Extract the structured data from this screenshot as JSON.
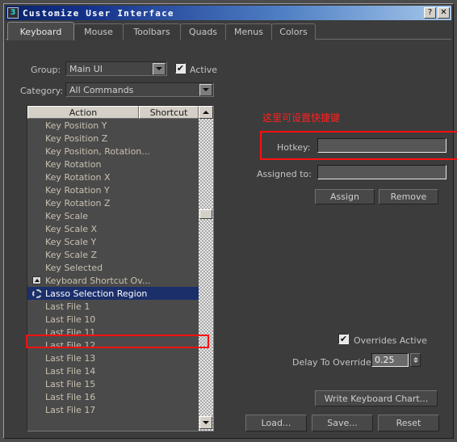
{
  "window": {
    "title": "Customize User Interface",
    "app_icon": "max-app-icon",
    "help_button": "?",
    "close_button": "✕"
  },
  "tabs": [
    {
      "label": "Keyboard",
      "active": true
    },
    {
      "label": "Mouse",
      "active": false
    },
    {
      "label": "Toolbars",
      "active": false
    },
    {
      "label": "Quads",
      "active": false
    },
    {
      "label": "Menus",
      "active": false
    },
    {
      "label": "Colors",
      "active": false
    }
  ],
  "left": {
    "group_label": "Group:",
    "group_value": "Main UI",
    "active_label": "Active",
    "active_checked": true,
    "active_check_glyph": "✔",
    "category_label": "Category:",
    "category_value": "All Commands",
    "columns": {
      "action": "Action",
      "shortcut": "Shortcut"
    },
    "rows": [
      {
        "label": "Key Position Y",
        "icon": "",
        "selected": false
      },
      {
        "label": "Key Position Z",
        "icon": "",
        "selected": false
      },
      {
        "label": "Key Position, Rotation...",
        "icon": "",
        "selected": false
      },
      {
        "label": "Key Rotation",
        "icon": "",
        "selected": false
      },
      {
        "label": "Key Rotation X",
        "icon": "",
        "selected": false
      },
      {
        "label": "Key Rotation Y",
        "icon": "",
        "selected": false
      },
      {
        "label": "Key Rotation Z",
        "icon": "",
        "selected": false
      },
      {
        "label": "Key Scale",
        "icon": "",
        "selected": false
      },
      {
        "label": "Key Scale X",
        "icon": "",
        "selected": false
      },
      {
        "label": "Key Scale Y",
        "icon": "",
        "selected": false
      },
      {
        "label": "Key Scale Z",
        "icon": "",
        "selected": false
      },
      {
        "label": "Key Selected",
        "icon": "",
        "selected": false
      },
      {
        "label": "Keyboard Shortcut Ov...",
        "icon": "keyboard-icon",
        "selected": false
      },
      {
        "label": "Lasso Selection Region",
        "icon": "lasso-icon",
        "selected": true
      },
      {
        "label": "Last File 1",
        "icon": "",
        "selected": false
      },
      {
        "label": "Last File 10",
        "icon": "",
        "selected": false
      },
      {
        "label": "Last File 11",
        "icon": "",
        "selected": false
      },
      {
        "label": "Last File 12",
        "icon": "",
        "selected": false
      },
      {
        "label": "Last File 13",
        "icon": "",
        "selected": false
      },
      {
        "label": "Last File 14",
        "icon": "",
        "selected": false
      },
      {
        "label": "Last File 15",
        "icon": "",
        "selected": false
      },
      {
        "label": "Last File 16",
        "icon": "",
        "selected": false
      },
      {
        "label": "Last File 17",
        "icon": "",
        "selected": false
      }
    ]
  },
  "right": {
    "annotation": "这里可设置快捷键",
    "annotation_color": "#ff2020",
    "hotkey_label": "Hotkey:",
    "hotkey_value": "",
    "hotkey_placeholder": "",
    "assigned_label": "Assigned to:",
    "assigned_value": "",
    "assign_button": "Assign",
    "remove_button": "Remove",
    "overrides_label": "Overrides Active",
    "overrides_checked": true,
    "overrides_check_glyph": "✔",
    "delay_label": "Delay To Override:",
    "delay_value": "0.25",
    "write_chart_button": "Write Keyboard Chart...",
    "load_button": "Load...",
    "save_button": "Save...",
    "reset_button": "Reset"
  }
}
